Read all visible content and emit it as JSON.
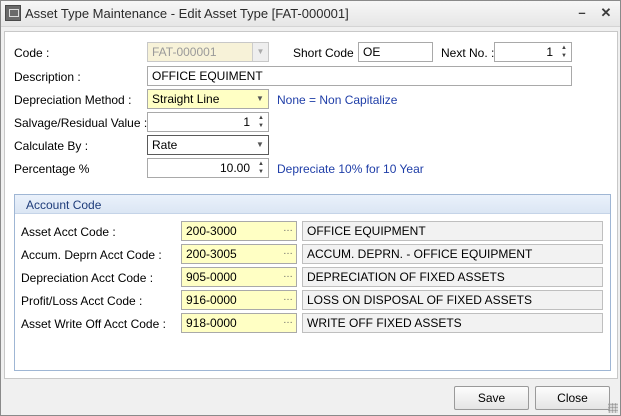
{
  "window": {
    "title": "Asset Type Maintenance - Edit Asset Type [FAT-000001]",
    "minimize_glyph": "–",
    "close_glyph": "✕"
  },
  "form": {
    "code_label": "Code :",
    "code_value": "FAT-000001",
    "short_code_label": "Short Code :",
    "short_code_value": "OE",
    "next_no_label": "Next No. :",
    "next_no_value": "1",
    "description_label": "Description :",
    "description_value": "OFFICE EQUIMENT",
    "depreciation_method_label": "Depreciation Method :",
    "depreciation_method_value": "Straight Line",
    "depreciation_method_hint": "None = Non Capitalize",
    "salvage_label": "Salvage/Residual Value :",
    "salvage_value": "1",
    "calculate_by_label": "Calculate By :",
    "calculate_by_value": "Rate",
    "percentage_label": "Percentage %",
    "percentage_value": "10.00",
    "percentage_hint": "Depreciate 10% for 10 Year"
  },
  "account_code": {
    "group_title": "Account Code",
    "rows": [
      {
        "label": "Asset Acct Code :",
        "code": "200-3000",
        "description": "OFFICE EQUIPMENT"
      },
      {
        "label": "Accum. Deprn Acct Code :",
        "code": "200-3005",
        "description": "ACCUM. DEPRN. - OFFICE EQUIPMENT"
      },
      {
        "label": "Depreciation Acct Code :",
        "code": "905-0000",
        "description": "DEPRECIATION OF FIXED ASSETS"
      },
      {
        "label": "Profit/Loss Acct Code :",
        "code": "916-0000",
        "description": "LOSS ON DISPOSAL OF FIXED ASSETS"
      },
      {
        "label": "Asset Write Off Acct Code :",
        "code": "918-0000",
        "description": "WRITE OFF FIXED ASSETS"
      }
    ]
  },
  "footer": {
    "save_label": "Save",
    "close_label": "Close"
  },
  "colors": {
    "required_field": "#ffffc4",
    "hint_text": "#1f3ea8",
    "group_border": "#9fb6d4"
  }
}
